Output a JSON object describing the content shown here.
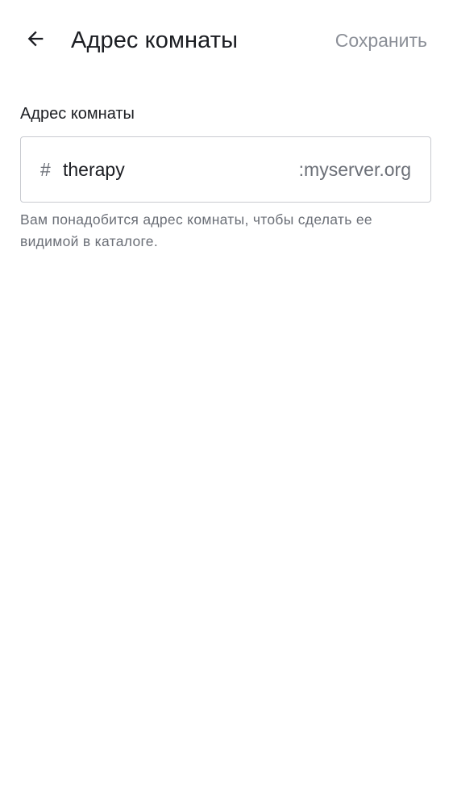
{
  "header": {
    "back_icon": "arrow-left-icon",
    "title": "Адрес комнаты",
    "save_label": "Сохранить"
  },
  "address_field": {
    "label": "Адрес комнаты",
    "prefix": "#",
    "value": "therapy",
    "suffix": ":myserver.org",
    "helper_text": "Вам понадобится адрес комнаты, чтобы сделать ее видимой в каталоге."
  },
  "colors": {
    "text_primary": "#1b1d22",
    "text_secondary": "#6b6f77",
    "save_disabled": "#8b8f97",
    "border": "#c8cad0"
  }
}
